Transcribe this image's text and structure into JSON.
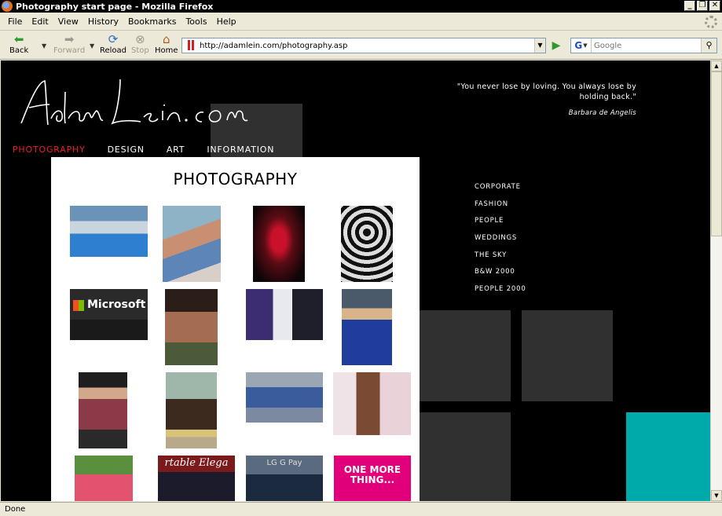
{
  "window": {
    "title": "Photography start page - Mozilla Firefox"
  },
  "menu": [
    "File",
    "Edit",
    "View",
    "History",
    "Bookmarks",
    "Tools",
    "Help"
  ],
  "nav": {
    "back": "Back",
    "forward": "Forward",
    "reload": "Reload",
    "stop": "Stop",
    "home": "Home"
  },
  "address": {
    "url": "http://adamlein.com/photography.asp"
  },
  "search": {
    "placeholder": "Google",
    "engine_letter": "G"
  },
  "status": "Done",
  "page": {
    "logo_text": "AdamLein.com",
    "quote": "\"You never lose by loving. You always lose by holding back.\"",
    "quote_author": "Barbara de Angelis",
    "topnav": [
      "PHOTOGRAPHY",
      "DESIGN",
      "ART",
      "INFORMATION"
    ],
    "categories": [
      "CORPORATE",
      "FASHION",
      "PEOPLE",
      "WEDDINGS",
      "THE SKY",
      "B&W 2000",
      "PEOPLE 2000"
    ],
    "panel_title": "PHOTOGRAPHY",
    "thumbnails": [
      {
        "name": "water-park-photo"
      },
      {
        "name": "girl-on-phone-photo"
      },
      {
        "name": "red-lightsaber-photo"
      },
      {
        "name": "top-hat-spiral-photo"
      },
      {
        "name": "microsoft-speaker-photo",
        "caption": "Microsoft"
      },
      {
        "name": "bikini-model-photo"
      },
      {
        "name": "wedding-kiss-photo"
      },
      {
        "name": "blue-dress-photo"
      },
      {
        "name": "gown-model-photo"
      },
      {
        "name": "horse-rider-photo"
      },
      {
        "name": "presenter-photo"
      },
      {
        "name": "lying-model-photo"
      },
      {
        "name": "pink-dress-photo"
      },
      {
        "name": "presenter-elegance-photo",
        "caption": "rtable Elega"
      },
      {
        "name": "lg-event-photo",
        "caption": "LG G Pay"
      },
      {
        "name": "tmobile-stage-photo",
        "caption": "ONE MORE THING..."
      }
    ],
    "colors": {
      "accent": "#ea2027",
      "teal": "#00aaaa",
      "tile": "#303030"
    }
  }
}
